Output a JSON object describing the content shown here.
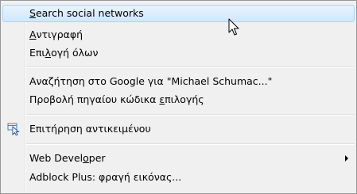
{
  "menu": {
    "items": [
      {
        "pre": "",
        "ul": "S",
        "post": "earch social networks"
      },
      {
        "pre": "",
        "ul": "Α",
        "post": "ντιγραφή"
      },
      {
        "pre": "Επι",
        "ul": "λ",
        "post": "ογή όλων"
      },
      {
        "pre": "Αναζήτηση στο Google για \"Michael Schumac...\"",
        "ul": "",
        "post": ""
      },
      {
        "pre": "Προβολή πηγαίου κώδικα ",
        "ul": "ε",
        "post": "πιλογής"
      },
      {
        "pre": "Επιτήρηση αντικειμένου",
        "ul": "",
        "post": ""
      },
      {
        "pre": "Web Devel",
        "ul": "o",
        "post": "per"
      },
      {
        "pre": "Adblock Plus: φραγή εικόνας...",
        "ul": "",
        "post": ""
      }
    ],
    "hovered_index": 0,
    "icons": {
      "inspect": "inspect-element-icon",
      "submenu": "submenu-arrow-icon",
      "cursor": "mouse-pointer-icon"
    },
    "colors": {
      "background": "#f0f0f0",
      "hover_border": "#a8d2f8",
      "hover_fill": "#dcecfc",
      "border": "#979797"
    }
  }
}
